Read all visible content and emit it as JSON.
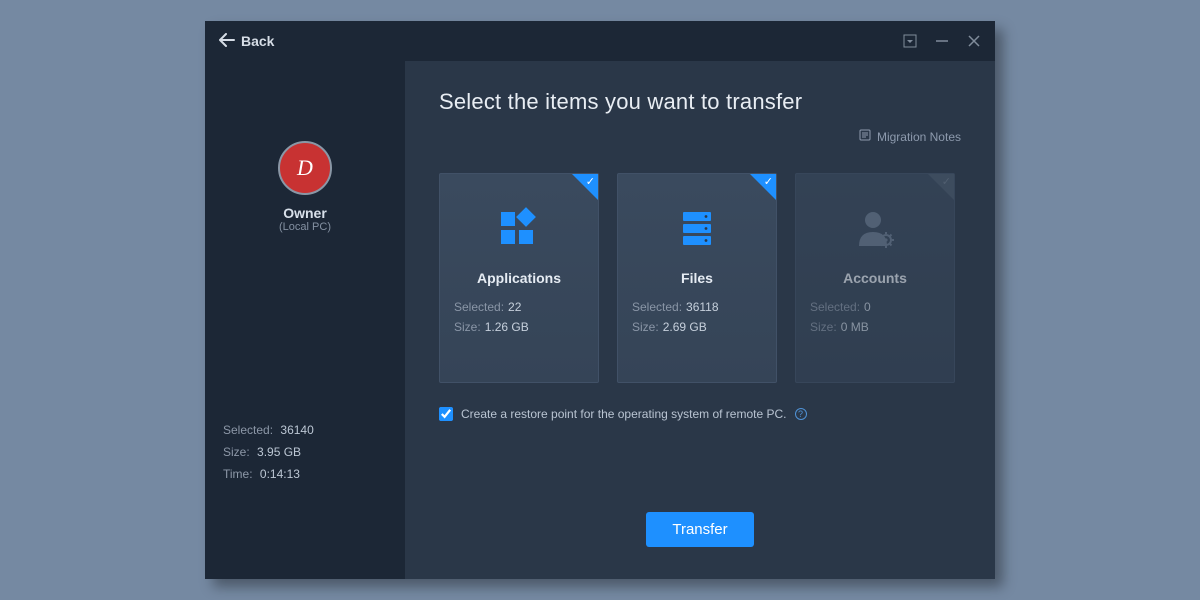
{
  "titlebar": {
    "back_label": "Back"
  },
  "sidebar": {
    "avatar_letter": "D",
    "owner_name": "Owner",
    "owner_sub": "(Local PC)",
    "stats": {
      "selected_label": "Selected:",
      "selected_value": "36140",
      "size_label": "Size:",
      "size_value": "3.95 GB",
      "time_label": "Time:",
      "time_value": "0:14:13"
    }
  },
  "main": {
    "title": "Select the items you want to transfer",
    "notes_label": "Migration Notes",
    "restore_label": "Create a restore point for the operating system of remote PC.",
    "transfer_button": "Transfer",
    "stat_selected_label": "Selected:",
    "stat_size_label": "Size:"
  },
  "cards": [
    {
      "title": "Applications",
      "selected": "22",
      "size": "1.26 GB",
      "checked": true
    },
    {
      "title": "Files",
      "selected": "36118",
      "size": "2.69 GB",
      "checked": true
    },
    {
      "title": "Accounts",
      "selected": "0",
      "size": "0 MB",
      "checked": false
    }
  ]
}
